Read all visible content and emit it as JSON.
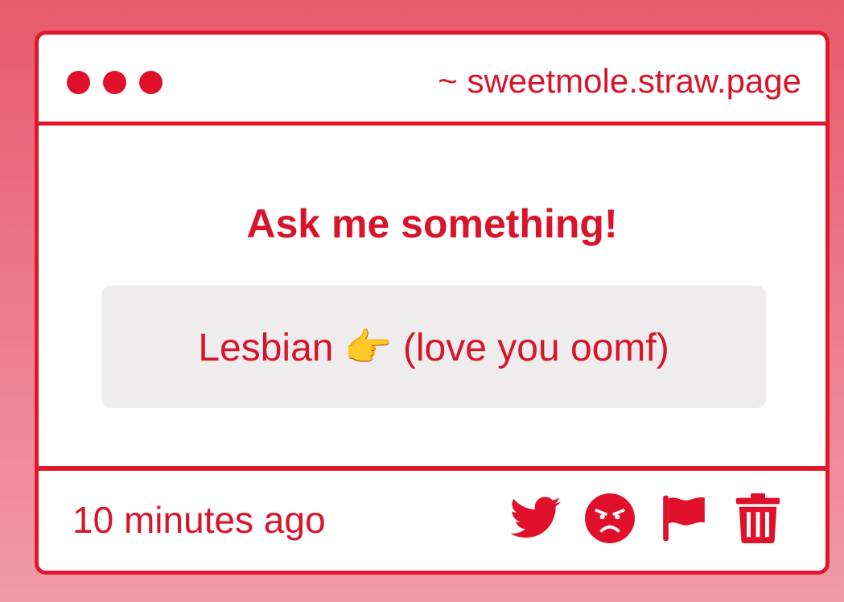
{
  "window": {
    "url": "~ sweetmole.straw.page"
  },
  "card": {
    "heading": "Ask me something!",
    "answer": "Lesbian 👉 (love you oomf)"
  },
  "footer": {
    "timestamp": "10 minutes ago",
    "actions": [
      {
        "icon": "twitter-icon"
      },
      {
        "icon": "angry-face-icon"
      },
      {
        "icon": "flag-icon"
      },
      {
        "icon": "trash-icon"
      }
    ]
  },
  "colors": {
    "accent": "#e0182e",
    "text": "#d7142b",
    "answer_bg": "#eeeced",
    "background_top": "#e75a6c",
    "background_bottom": "#f19aa6"
  }
}
